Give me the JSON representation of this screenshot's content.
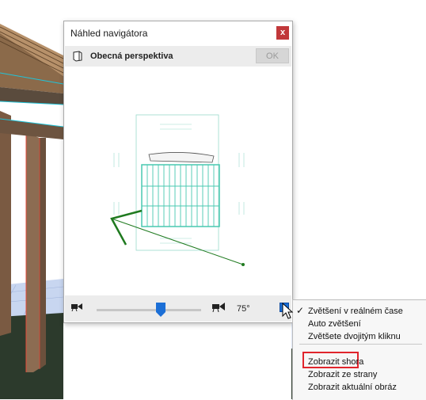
{
  "dialog": {
    "title": "Náhled navigátora",
    "close_label": "x",
    "view_name": "Obecná perspektiva",
    "ok_label": "OK",
    "angle": "75°",
    "zoom_slider_value": 0.62
  },
  "context_menu": {
    "items": [
      {
        "label": "Zvětšení v reálném čase",
        "checked": true
      },
      {
        "label": "Auto zvětšení",
        "checked": false
      },
      {
        "label": "Zvětšete dvojitým kliknu",
        "checked": false
      },
      {
        "label": "Zobrazit shora",
        "checked": false,
        "highlighted": true
      },
      {
        "label": "Zobrazit ze strany",
        "checked": false
      },
      {
        "label": "Zobrazit aktuální obráz",
        "checked": false
      }
    ]
  },
  "colors": {
    "close_button": "#c1383a",
    "highlight_box": "#e0242c",
    "plan_lines": "#48c9b0",
    "camera_line": "#1f7a1f",
    "menu_button": "#1c6fd6"
  },
  "icons": [
    "view-icon",
    "close-icon",
    "camera-left-icon",
    "camera-right-icon",
    "menu-arrow-icon",
    "check-icon",
    "mouse-cursor-icon"
  ]
}
